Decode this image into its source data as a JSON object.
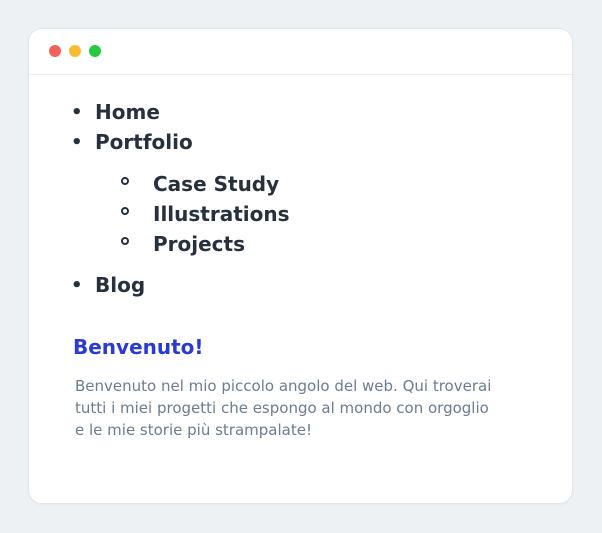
{
  "window": {
    "controls": [
      {
        "name": "close",
        "color": "#f4605b"
      },
      {
        "name": "minimize",
        "color": "#f8bc2e"
      },
      {
        "name": "maximize",
        "color": "#28c840"
      }
    ]
  },
  "nav": {
    "items": [
      {
        "label": "Home"
      },
      {
        "label": "Portfolio",
        "children": [
          {
            "label": "Case Study"
          },
          {
            "label": "Illustrations"
          },
          {
            "label": "Projects"
          }
        ]
      },
      {
        "label": "Blog"
      }
    ]
  },
  "welcome": {
    "title": "Benvenuto!",
    "body": "Benvenuto nel mio piccolo angolo del web. Qui troverai tutti i miei progetti che espongo al mondo con orgoglio e le mie storie più strampalate!"
  },
  "colors": {
    "accent": "#2a3bd1",
    "text": "#27303d",
    "muted": "#6b7c93"
  }
}
